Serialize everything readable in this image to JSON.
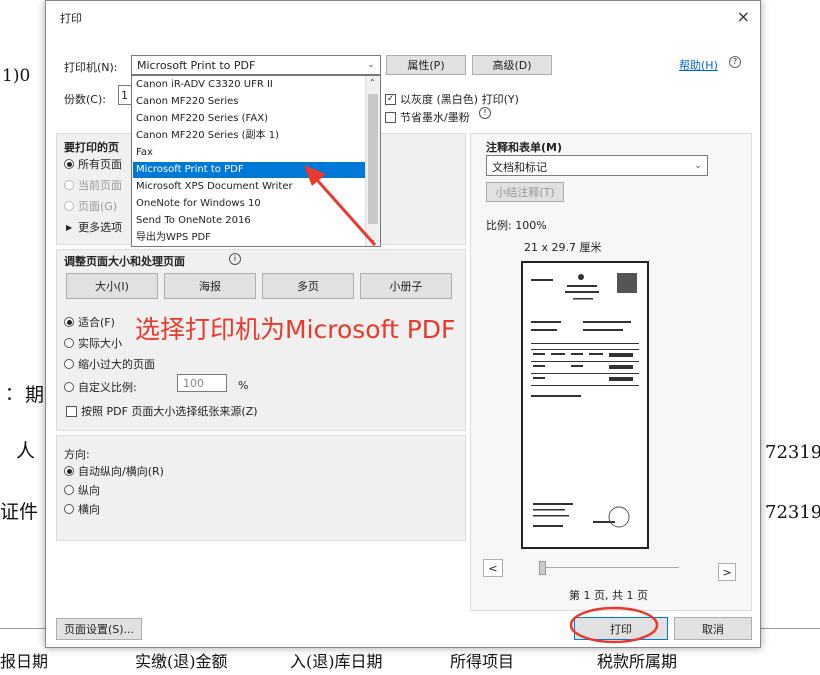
{
  "background": {
    "left_fragments": [
      "1)0",
      "∶ 期",
      "人",
      "证件"
    ],
    "right_fragments": [
      "72319",
      "72319"
    ],
    "bottom_headers": [
      "报日期",
      "实缴(退)金额",
      "入(退)库日期",
      "所得项目",
      "税款所属期"
    ]
  },
  "dialog": {
    "title": "打印",
    "close": "×",
    "printer_label": "打印机(N):",
    "printer_value": "Microsoft Print to PDF",
    "properties_button": "属性(P)",
    "advanced_button": "高级(D)",
    "help_link": "帮助(H)",
    "copies_label": "份数(C):",
    "copies_value": "1",
    "grayscale_label": "以灰度 (黑白色) 打印(Y)",
    "save_ink_label": "节省墨水/墨粉",
    "printer_options": [
      "Canon iR-ADV C3320 UFR II",
      "Canon MF220 Series",
      "Canon MF220 Series (FAX)",
      "Canon MF220 Series (副本 1)",
      "Fax",
      "Microsoft Print to PDF",
      "Microsoft XPS Document Writer",
      "OneNote for Windows 10",
      "Send To OneNote 2016",
      "导出为WPS PDF"
    ],
    "selected_option_index": 5,
    "pages_section_title": "要打印的页",
    "all_pages": "所有页面",
    "current_page": "当前页面",
    "pages": "页面(G)",
    "more_options": "更多选项",
    "annotations_title": "注释和表单(M)",
    "annotations_value": "文档和标记",
    "summarize_button": "小结注释(T)",
    "scale_label": "比例: 100%",
    "paper_size": "21 x 29.7 厘米",
    "sizing_title": "调整页面大小和处理页面",
    "size_tabs": [
      "大小(I)",
      "海报",
      "多页",
      "小册子"
    ],
    "fit": "适合(F)",
    "actual_size": "实际大小",
    "shrink_oversized": "缩小过大的页面",
    "custom_scale": "自定义比例:",
    "custom_scale_value": "100",
    "percent": "%",
    "pdf_page_size": "按照 PDF 页面大小选择纸张来源(Z)",
    "orientation_title": "方向:",
    "auto_orientation": "自动纵向/横向(R)",
    "portrait": "纵向",
    "landscape": "横向",
    "page_indicator": "第 1 页, 共 1 页",
    "page_setup_button": "页面设置(S)...",
    "print_button": "打印",
    "cancel_button": "取消",
    "prev": "<",
    "next": ">"
  },
  "annotation_text": "选择打印机为Microsoft PDF",
  "colors": {
    "annotation": "#e8392c",
    "selection": "#0078d7",
    "link": "#0066cc"
  },
  "icons": [
    "dropdown-arrow-icon",
    "help-circle-icon",
    "info-icon",
    "red-arrow-icon",
    "red-ellipse-icon",
    "qr-code-icon",
    "emblem-icon",
    "stamp-icon"
  ]
}
